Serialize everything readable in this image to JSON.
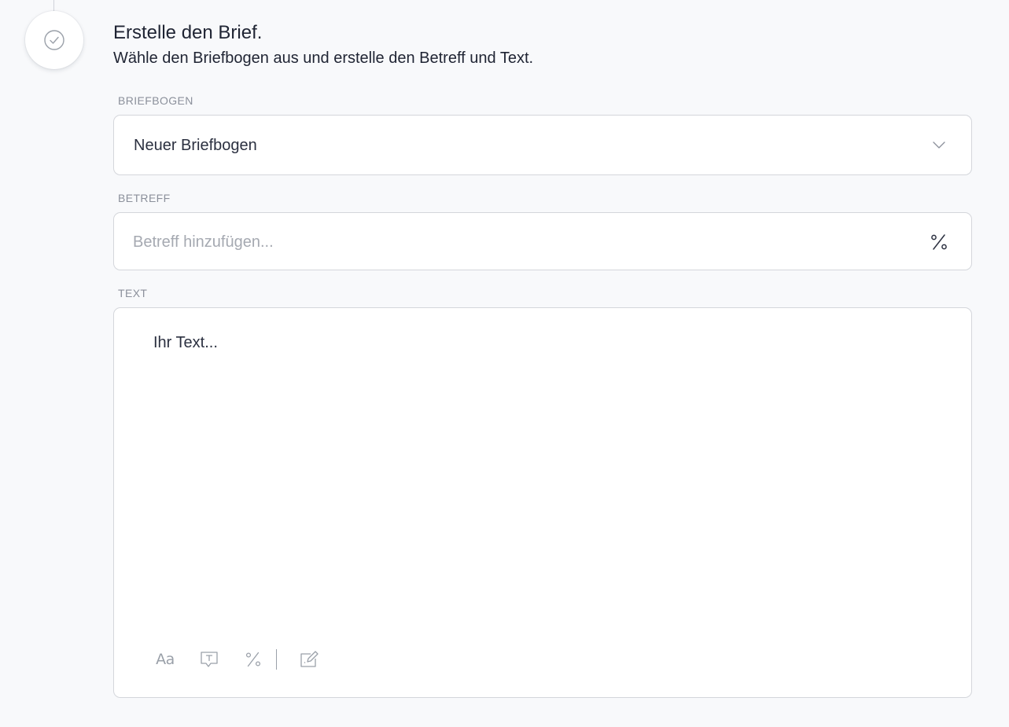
{
  "step": {
    "icon": "check-circle-icon",
    "title": "Erstelle den Brief.",
    "subtitle": "Wähle den Briefbogen aus und erstelle den Betreff und Text."
  },
  "letterhead": {
    "label": "BRIEFBOGEN",
    "selected": "Neuer Briefbogen",
    "icon": "chevron-down-icon"
  },
  "subject": {
    "label": "BETREFF",
    "value": "",
    "placeholder": "Betreff hinzufügen...",
    "icon": "percent-icon"
  },
  "text": {
    "label": "TEXT",
    "content": "Ihr Text...",
    "toolbar": {
      "format_label": "Aa",
      "icons": [
        "text-format-icon",
        "text-block-icon",
        "percent-icon",
        "signature-icon"
      ]
    }
  },
  "colors": {
    "background": "#f8f9fb",
    "border": "#d4d6db",
    "label": "#8b909b",
    "icon": "#9aa0a9",
    "text": "#1f2433"
  }
}
